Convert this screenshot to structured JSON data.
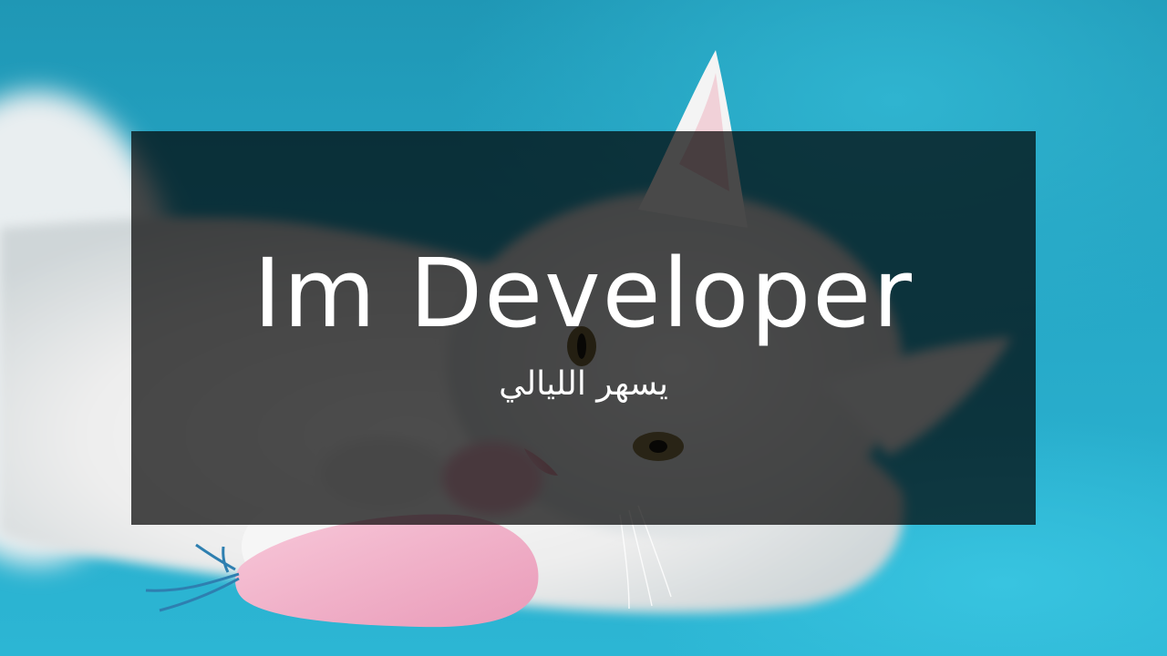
{
  "hero": {
    "title": "Im Developer",
    "subtitle": "يسهر الليالي"
  },
  "colors": {
    "background": "#29a9c6",
    "overlay": "rgba(0,0,0,0.70)",
    "text": "#ffffff",
    "cat_fur": "#f2f2f2",
    "toy": "#f3b5cc"
  },
  "image": {
    "subject": "white kitten lying on blue background hugging a pink toy"
  }
}
